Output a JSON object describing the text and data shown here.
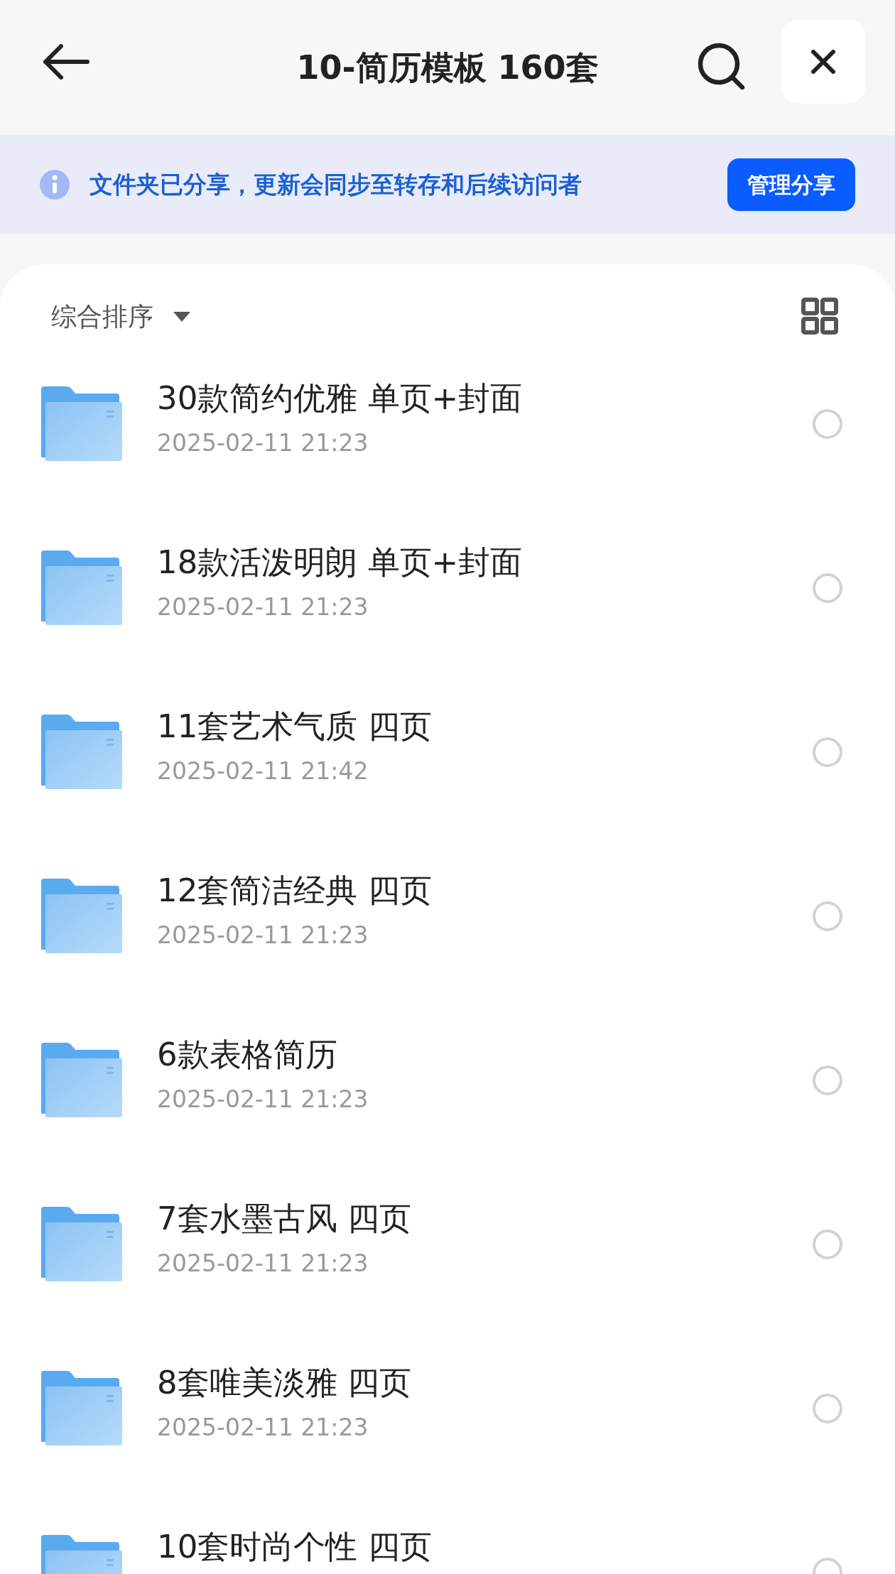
{
  "header": {
    "title": "10-简历模板 160套"
  },
  "banner": {
    "message": "文件夹已分享，更新会同步至转存和后续访问者",
    "button": "管理分享"
  },
  "sort": {
    "label": "综合排序"
  },
  "files": [
    {
      "name": "30款简约优雅 单页+封面",
      "date": "2025-02-11 21:23",
      "selected": false
    },
    {
      "name": "18款活泼明朗 单页+封面",
      "date": "2025-02-11 21:23",
      "selected": false
    },
    {
      "name": "11套艺术气质 四页",
      "date": "2025-02-11 21:42",
      "selected": false
    },
    {
      "name": "12套简洁经典 四页",
      "date": "2025-02-11 21:23",
      "selected": false
    },
    {
      "name": "6款表格简历",
      "date": "2025-02-11 21:23",
      "selected": false
    },
    {
      "name": "7套水墨古风 四页",
      "date": "2025-02-11 21:23",
      "selected": false
    },
    {
      "name": "8套唯美淡雅 四页",
      "date": "2025-02-11 21:23",
      "selected": false
    },
    {
      "name": "10套时尚个性 四页",
      "selected": false
    }
  ]
}
